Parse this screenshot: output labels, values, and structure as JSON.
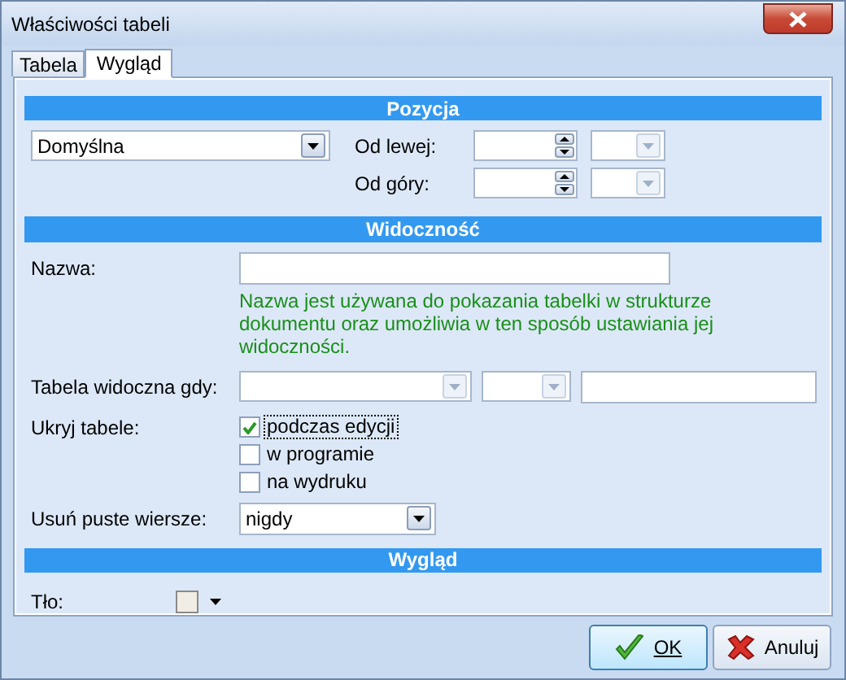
{
  "window": {
    "title": "Właściwości tabeli"
  },
  "tabs": [
    {
      "label": "Tabela",
      "selected": false
    },
    {
      "label": "Wygląd",
      "selected": true
    }
  ],
  "position": {
    "header": "Pozycja",
    "mode": {
      "value": "Domyślna"
    },
    "offsets": [
      {
        "label": "Od lewej:"
      },
      {
        "label": "Od góry:"
      }
    ]
  },
  "visibility": {
    "header": "Widoczność",
    "name": {
      "label": "Nazwa:"
    },
    "hint": "Nazwa jest używana do pokazania tabelki w strukturze dokumentu oraz umożliwia w ten sposób ustawiania jej widoczności.",
    "visible_when": {
      "label": "Tabela widoczna gdy:"
    },
    "hide": {
      "label": "Ukryj tabele:",
      "options": [
        {
          "label": "podczas edycji",
          "checked": true,
          "focused": true
        },
        {
          "label": "w programie",
          "checked": false,
          "focused": false
        },
        {
          "label": "na wydruku",
          "checked": false,
          "focused": false
        }
      ]
    },
    "remove_empty": {
      "label": "Usuń puste wiersze:",
      "value": "nigdy"
    }
  },
  "appearance": {
    "header": "Wygląd",
    "background": {
      "label": "Tło:"
    }
  },
  "buttons": [
    {
      "kind": "ok",
      "label": "OK"
    },
    {
      "kind": "cancel",
      "label": "Anuluj"
    }
  ]
}
